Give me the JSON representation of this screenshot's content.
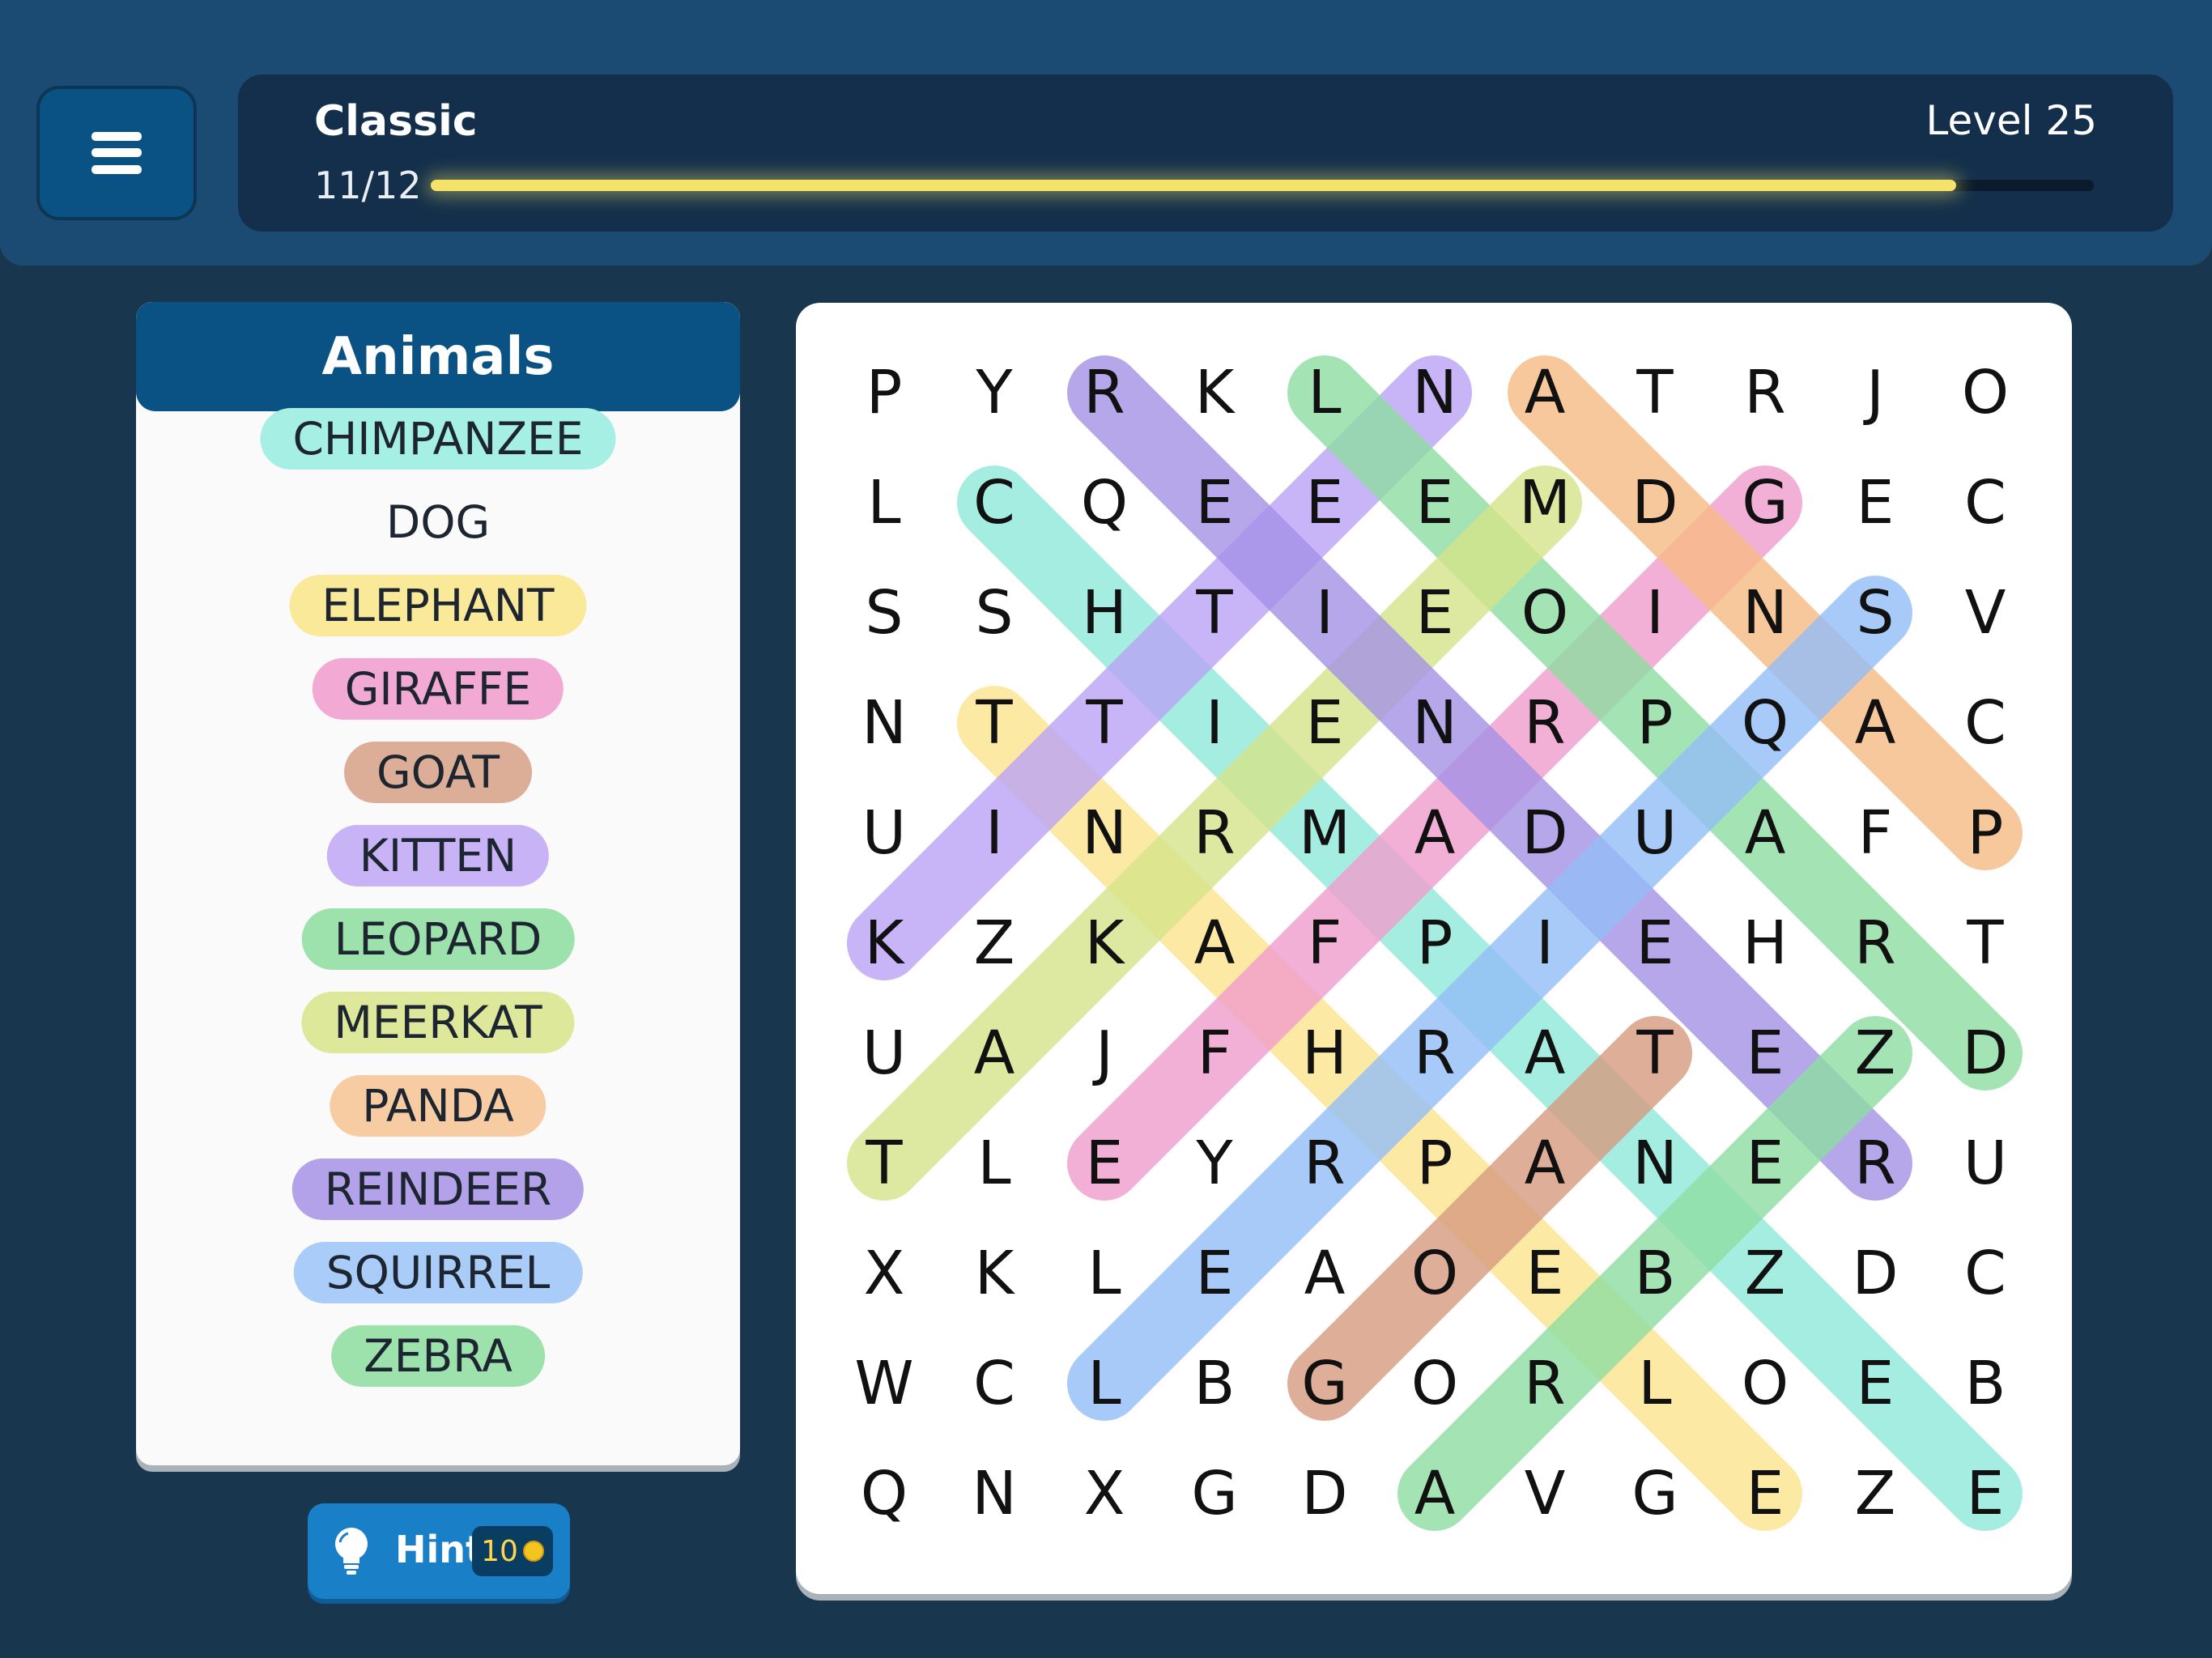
{
  "header": {
    "mode": "Classic",
    "found_text": "11/12",
    "level": "Level 25",
    "progress": 0.917
  },
  "words_panel": {
    "title": "Animals",
    "words": [
      {
        "text": "CHIMPANZEE",
        "color": "#a5efe4"
      },
      {
        "text": "DOG",
        "color": null
      },
      {
        "text": "ELEPHANT",
        "color": "#fbe99a"
      },
      {
        "text": "GIRAFFE",
        "color": "#f2a9d3"
      },
      {
        "text": "GOAT",
        "color": "#dcae98"
      },
      {
        "text": "KITTEN",
        "color": "#c7b3f5"
      },
      {
        "text": "LEOPARD",
        "color": "#9de2ad"
      },
      {
        "text": "MEERKAT",
        "color": "#dde89b"
      },
      {
        "text": "PANDA",
        "color": "#f8cca2"
      },
      {
        "text": "REINDEER",
        "color": "#b3a1e9"
      },
      {
        "text": "SQUIRREL",
        "color": "#a9cdf8"
      },
      {
        "text": "ZEBRA",
        "color": "#9de2ad"
      }
    ]
  },
  "hint": {
    "label": "Hint",
    "cost": "10",
    "icon": "lightbulb-icon",
    "coin_icon": "coin-icon"
  },
  "grid": {
    "rows": [
      "PYRKLNATRJO",
      "LCQEEEMDGEC",
      "SSHTIEOINSV",
      "NTTIENRPQAC",
      "UINRMADUAFP",
      "KZKAFPIEHRT",
      "UAJFHRATEZD",
      "TLEYRPANERU",
      "XKLEAOEBZDC",
      "WCLBGORLOEB",
      "QNXGDAVGEZE"
    ],
    "found": [
      {
        "word": "CHIMPANZEE",
        "start": [
          1,
          1
        ],
        "end": [
          10,
          10
        ],
        "color": "#8fe8da"
      },
      {
        "word": "ELEPHANT",
        "start": [
          10,
          8
        ],
        "end": [
          3,
          1
        ],
        "color": "#fbe48c"
      },
      {
        "word": "GIRAFFE",
        "start": [
          1,
          8
        ],
        "end": [
          7,
          2
        ],
        "color": "#f09ccc"
      },
      {
        "word": "GOAT",
        "start": [
          9,
          4
        ],
        "end": [
          6,
          7
        ],
        "color": "#d69a80"
      },
      {
        "word": "KITTEN",
        "start": [
          5,
          0
        ],
        "end": [
          0,
          5
        ],
        "color": "#b9a2f5"
      },
      {
        "word": "LEOPARD",
        "start": [
          0,
          4
        ],
        "end": [
          6,
          10
        ],
        "color": "#8ddda1"
      },
      {
        "word": "MEERKAT",
        "start": [
          1,
          6
        ],
        "end": [
          7,
          0
        ],
        "color": "#d4e48a"
      },
      {
        "word": "PANDA",
        "start": [
          4,
          10
        ],
        "end": [
          0,
          6
        ],
        "color": "#f6ba85"
      },
      {
        "word": "REINDEER",
        "start": [
          0,
          2
        ],
        "end": [
          7,
          9
        ],
        "color": "#a491e6"
      },
      {
        "word": "SQUIRREL",
        "start": [
          2,
          9
        ],
        "end": [
          9,
          2
        ],
        "color": "#92bdf6"
      },
      {
        "word": "ZEBRA",
        "start": [
          6,
          9
        ],
        "end": [
          10,
          5
        ],
        "color": "#8ddda1"
      }
    ]
  }
}
